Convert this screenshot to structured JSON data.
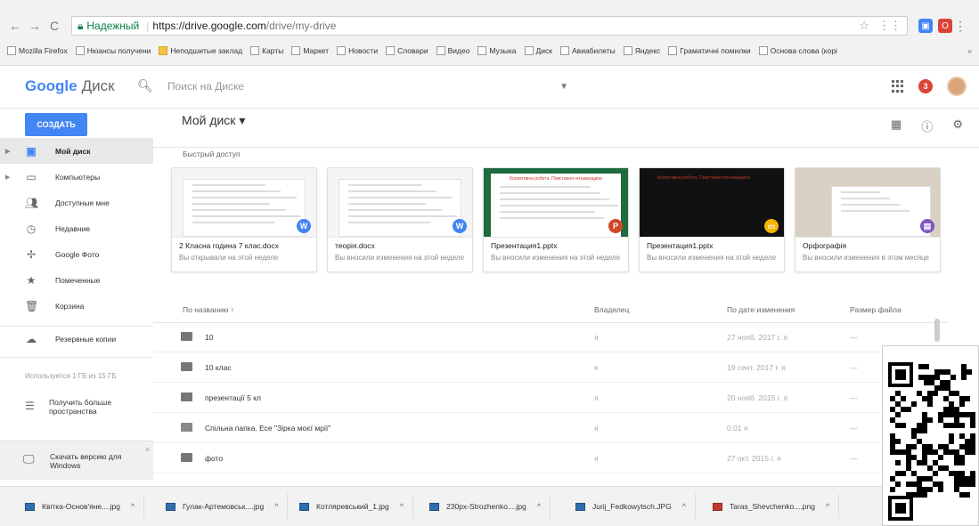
{
  "browser": {
    "secure_label": "Надежный",
    "url_host": "https://drive.google.com",
    "url_path": "/drive/my-drive",
    "bookmarks": [
      {
        "label": "Mozilla Firefox",
        "folder": false
      },
      {
        "label": "Нюансы получени",
        "folder": false
      },
      {
        "label": "Неподшитые заклад",
        "folder": true
      },
      {
        "label": "Карты",
        "folder": false
      },
      {
        "label": "Маркет",
        "folder": false
      },
      {
        "label": "Новости",
        "folder": false
      },
      {
        "label": "Словари",
        "folder": false
      },
      {
        "label": "Видео",
        "folder": false
      },
      {
        "label": "Музыка",
        "folder": false
      },
      {
        "label": "Диск",
        "folder": false
      },
      {
        "label": "Авиабилеты",
        "folder": false
      },
      {
        "label": "Яндекс",
        "folder": false
      },
      {
        "label": "Граматичні помилки",
        "folder": false
      },
      {
        "label": "Основа слова (корі",
        "folder": false
      }
    ],
    "bookmarks_more": "»"
  },
  "header": {
    "logo_google": "Google",
    "logo_product": "Диск",
    "search_placeholder": "Поиск на Диске",
    "notifications_count": "3"
  },
  "subbar": {
    "create_label": "СОЗДАТЬ",
    "location_label": "Мой диск ▾"
  },
  "sidebar": {
    "items": [
      {
        "label": "Мой диск",
        "icon": "drive-icon"
      },
      {
        "label": "Компьютеры",
        "icon": "computer-icon"
      },
      {
        "label": "Доступные мне",
        "icon": "people-icon"
      },
      {
        "label": "Недавние",
        "icon": "clock-icon"
      },
      {
        "label": "Google Фото",
        "icon": "pinwheel-icon"
      },
      {
        "label": "Помеченные",
        "icon": "star-icon"
      },
      {
        "label": "Корзина",
        "icon": "trash-icon"
      },
      {
        "label": "Резервные копии",
        "icon": "cloud-icon"
      }
    ],
    "storage_text": "Используется 1 ГБ из 15 ГБ",
    "get_more_label": "Получить больше пространства",
    "download_label": "Скачать версию для Windows",
    "close_symbol": "×"
  },
  "quick_access": {
    "title": "Быстрый доступ",
    "cards": [
      {
        "name": "2 Класна година 7 клас.docx",
        "desc": "Вы открывали на этой неделе",
        "badge": "W",
        "badge_color": "#4285f4"
      },
      {
        "name": "теорія.docx",
        "desc": "Вы вносили изменения на этой неделе",
        "badge": "W",
        "badge_color": "#4285f4"
      },
      {
        "name": "Презентация1.pptx",
        "desc": "Вы вносили изменения на этой неделе",
        "badge": "P",
        "badge_color": "#d24726",
        "slide_title": "Колективна робота. Повстання гетьманщина"
      },
      {
        "name": "Презентация1.pptx",
        "desc": "Вы вносили изменения на этой неделе",
        "badge": "▭",
        "badge_color": "#f4b400",
        "slide_title": "Колективна робота. Повстання гетьманщина"
      },
      {
        "name": "Орфографія",
        "desc": "Вы вносили изменения в этом месяце",
        "badge": "▤",
        "badge_color": "#7e57c2"
      }
    ]
  },
  "table": {
    "headers": {
      "name": "По названию ↑",
      "owner": "Владелец",
      "modified": "По дате изменения",
      "size": "Размер файла"
    },
    "rows": [
      {
        "name": "10",
        "owner": "я",
        "modified": "27 нояб. 2017 г. я",
        "size": "—",
        "shared": false
      },
      {
        "name": "10 клас",
        "owner": "я",
        "modified": "19 сент. 2017 г. я",
        "size": "—",
        "shared": false
      },
      {
        "name": "презентації 5 кл",
        "owner": "я",
        "modified": "20 нояб. 2015 г. я",
        "size": "—",
        "shared": false
      },
      {
        "name": "Спільна папка. Есе \"Зірка моєї мрії\"",
        "owner": "я",
        "modified": "0:01 я",
        "size": "—",
        "shared": true
      },
      {
        "name": "фото",
        "owner": "я",
        "modified": "27 окт. 2015 г. я",
        "size": "—",
        "shared": false
      }
    ]
  },
  "downloads": [
    {
      "name": "Квітка-Основ'яне....jpg",
      "type": "jpg"
    },
    {
      "name": "Гулак-Артемовськ....jpg",
      "type": "jpg"
    },
    {
      "name": "Котляревський_1.jpg",
      "type": "jpg"
    },
    {
      "name": "230px-Strozhenko....jpg",
      "type": "jpg"
    },
    {
      "name": "Jurij_Fedkowytsch.JPG",
      "type": "jpg"
    },
    {
      "name": "Taras_Shevchenko....png",
      "type": "png"
    }
  ]
}
